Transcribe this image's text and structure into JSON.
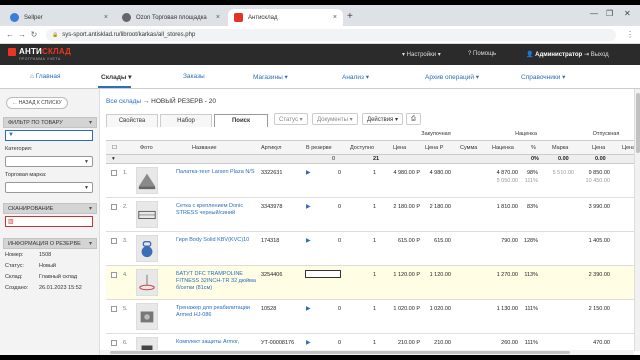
{
  "browser": {
    "tabs": [
      {
        "title": "Sellper",
        "color": "#3b7dd8"
      },
      {
        "title": "Ozon Торговая площадка",
        "color": "#666666"
      },
      {
        "title": "Антисклад",
        "color": "#e33322"
      }
    ],
    "url": "sys-sport.antisklad.ru/libroot/karkas/all_stores.php",
    "new_tab": "+",
    "close": "×"
  },
  "app_header": {
    "logo_main": "АНТИ",
    "logo_accent": "СКЛАД",
    "logo_sub": "ПРОГРАММА УЧЕТА",
    "settings": "▾ Настройки ▾",
    "help": "? Помощь",
    "user": "Администратор",
    "logout": "Выход"
  },
  "main_menu": {
    "items": [
      {
        "label": "Главная",
        "icon": "home-icon"
      },
      {
        "label": "Склады ▾"
      },
      {
        "label": "Заказы"
      },
      {
        "label": "Магазины ▾"
      },
      {
        "label": "Анализ ▾"
      },
      {
        "label": "Архив операций ▾"
      },
      {
        "label": "Справочники ▾"
      }
    ]
  },
  "sidebar": {
    "back": "← НАЗАД К СПИСКУ",
    "filter_title": "ФИЛЬТР ПО ТОВАРУ",
    "category_label": "Категория:",
    "brand_label": "Торговая марка:",
    "scan_title": "СКАНИРОВАНИЕ",
    "info_title": "ИНФОРМАЦИЯ О РЕЗЕРВЕ",
    "info": [
      {
        "key": "Номер:",
        "value": "1508"
      },
      {
        "key": "Статус:",
        "value": "Новый"
      },
      {
        "key": "Склад:",
        "value": "Главный склад"
      },
      {
        "key": "Создано:",
        "value": "26.01.2023 15:52"
      }
    ]
  },
  "content": {
    "crumb_link": "Все склады",
    "crumb_arrow": "→",
    "crumb_current": "НОВЫЙ РЕЗЕРВ - 20",
    "tabs": [
      "Свойства",
      "Набор",
      "Поиск"
    ],
    "tools": {
      "status": "Статус ▾",
      "docs": "Документы ▾",
      "actions": "Действия ▾"
    },
    "groups": {
      "purchase": "Закупочная",
      "markup": "Наценка",
      "sale": "Отпускная"
    },
    "headers": [
      "Фото",
      "Название",
      "Артикул",
      "В резерве",
      "Доступно",
      "Цена",
      "Цена Р",
      "Сумма",
      "Наценка",
      "%",
      "Марка",
      "Цена",
      "Цена"
    ],
    "sum_row": {
      "reserved": "0",
      "available": "21",
      "pct": "0%",
      "mark": "0.00",
      "price": "0.00"
    },
    "rows": [
      {
        "num": "1.",
        "name": "Палатка-тент Larsen Plaza N/S",
        "sku": "3322631",
        "reserved": "0",
        "available": "1",
        "price": "4 980.00 Р",
        "price_r": "4 980.00",
        "sum": "",
        "markup": "4 870.00",
        "markup_sub": "5 050.00",
        "pct": "98%",
        "pct_sub": "111%",
        "mark": "5 510.00",
        "sale": "9 850.00",
        "sale_sub": "10 450.00"
      },
      {
        "num": "2.",
        "name": "Сетка с креплением Donic STRESS черный/синий",
        "sku": "3343978",
        "reserved": "0",
        "available": "1",
        "price": "2 180.00 Р",
        "price_r": "2 180.00",
        "sum": "",
        "markup": "1 810.00",
        "markup_sub": "",
        "pct": "83%",
        "pct_sub": "",
        "mark": "",
        "sale": "3 990.00",
        "sale_sub": ""
      },
      {
        "num": "3.",
        "name": "Гиря Body Solid KBV(KVC)10",
        "sku": "174318",
        "reserved": "0",
        "available": "1",
        "price": "615.00 Р",
        "price_r": "615.00",
        "sum": "",
        "markup": "790.00",
        "markup_sub": "",
        "pct": "128%",
        "pct_sub": "",
        "mark": "",
        "sale": "1 405.00",
        "sale_sub": ""
      },
      {
        "num": "4.",
        "name": "БАТУТ DFC TRAMPOLINE FITNESS 32INCH-TR 32 дюйма б/сетки (81см)",
        "sku": "3254406",
        "reserved": "",
        "available": "1",
        "price": "1 120.00 Р",
        "price_r": "1 120.00",
        "sum": "",
        "markup": "1 270.00",
        "markup_sub": "",
        "pct": "113%",
        "pct_sub": "",
        "mark": "",
        "sale": "2 390.00",
        "sale_sub": ""
      },
      {
        "num": "5.",
        "name": "Тренажер для реабилитации Armed HJ-086",
        "sku": "10528",
        "reserved": "0",
        "available": "1",
        "price": "1 020.00 Р",
        "price_r": "1 020.00",
        "sum": "",
        "markup": "1 130.00",
        "markup_sub": "",
        "pct": "111%",
        "pct_sub": "",
        "mark": "",
        "sale": "2 150.00",
        "sale_sub": ""
      },
      {
        "num": "6.",
        "name": "Комплект защиты Armor,",
        "sku": "УТ-00008176",
        "reserved": "0",
        "available": "1",
        "price": "210.00 Р",
        "price_r": "210.00",
        "sum": "",
        "markup": "260.00",
        "markup_sub": "",
        "pct": "111%",
        "pct_sub": "",
        "mark": "",
        "sale": "470.00",
        "sale_sub": ""
      }
    ]
  }
}
